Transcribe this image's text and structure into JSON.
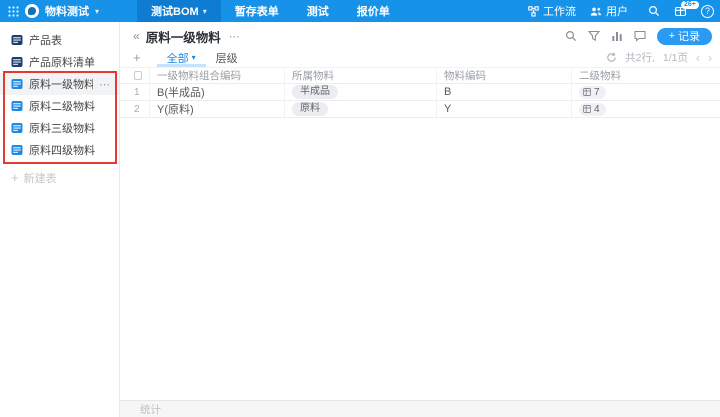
{
  "topbar": {
    "app_name": "物料测试",
    "nav": [
      {
        "label": "测试BOM"
      },
      {
        "label": "暂存表单"
      },
      {
        "label": "测试"
      },
      {
        "label": "报价单"
      }
    ],
    "workflow_label": "工作流",
    "users_label": "用户",
    "notification_badge": "26+"
  },
  "sidebar": {
    "items": [
      {
        "label": "产品表"
      },
      {
        "label": "产品原料清单"
      },
      {
        "label": "原料一级物料"
      },
      {
        "label": "原料二级物料"
      },
      {
        "label": "原料三级物料"
      },
      {
        "label": "原料四级物料"
      }
    ],
    "add_table_label": "新建表"
  },
  "main": {
    "title": "原料一级物料",
    "view_tabs": [
      {
        "label": "全部"
      },
      {
        "label": "层级"
      }
    ],
    "record_button_label": "记录",
    "row_count_label": "共2行,",
    "page_label": "1/1页",
    "footer_stats_label": "统计",
    "table": {
      "columns": [
        "一级物料组合编码",
        "所属物料",
        "物料编码",
        "二级物料"
      ],
      "rows": [
        {
          "index": "1",
          "combo_code": "B(半成品)",
          "material_type": "半成品",
          "material_code": "B",
          "level2_count": "7"
        },
        {
          "index": "2",
          "combo_code": "Y(原料)",
          "material_type": "原料",
          "material_code": "Y",
          "level2_count": "4"
        }
      ]
    }
  },
  "icons": {
    "ellipsis": "⋯",
    "collapse": "«",
    "prev": "‹",
    "next": "›",
    "plus": "+",
    "caret": "▾",
    "help": "?"
  },
  "colors": {
    "topbar": "#1792e9",
    "topbar_active": "#0d7cd2",
    "accent": "#2b9af3",
    "annotation": "#e23b34"
  }
}
